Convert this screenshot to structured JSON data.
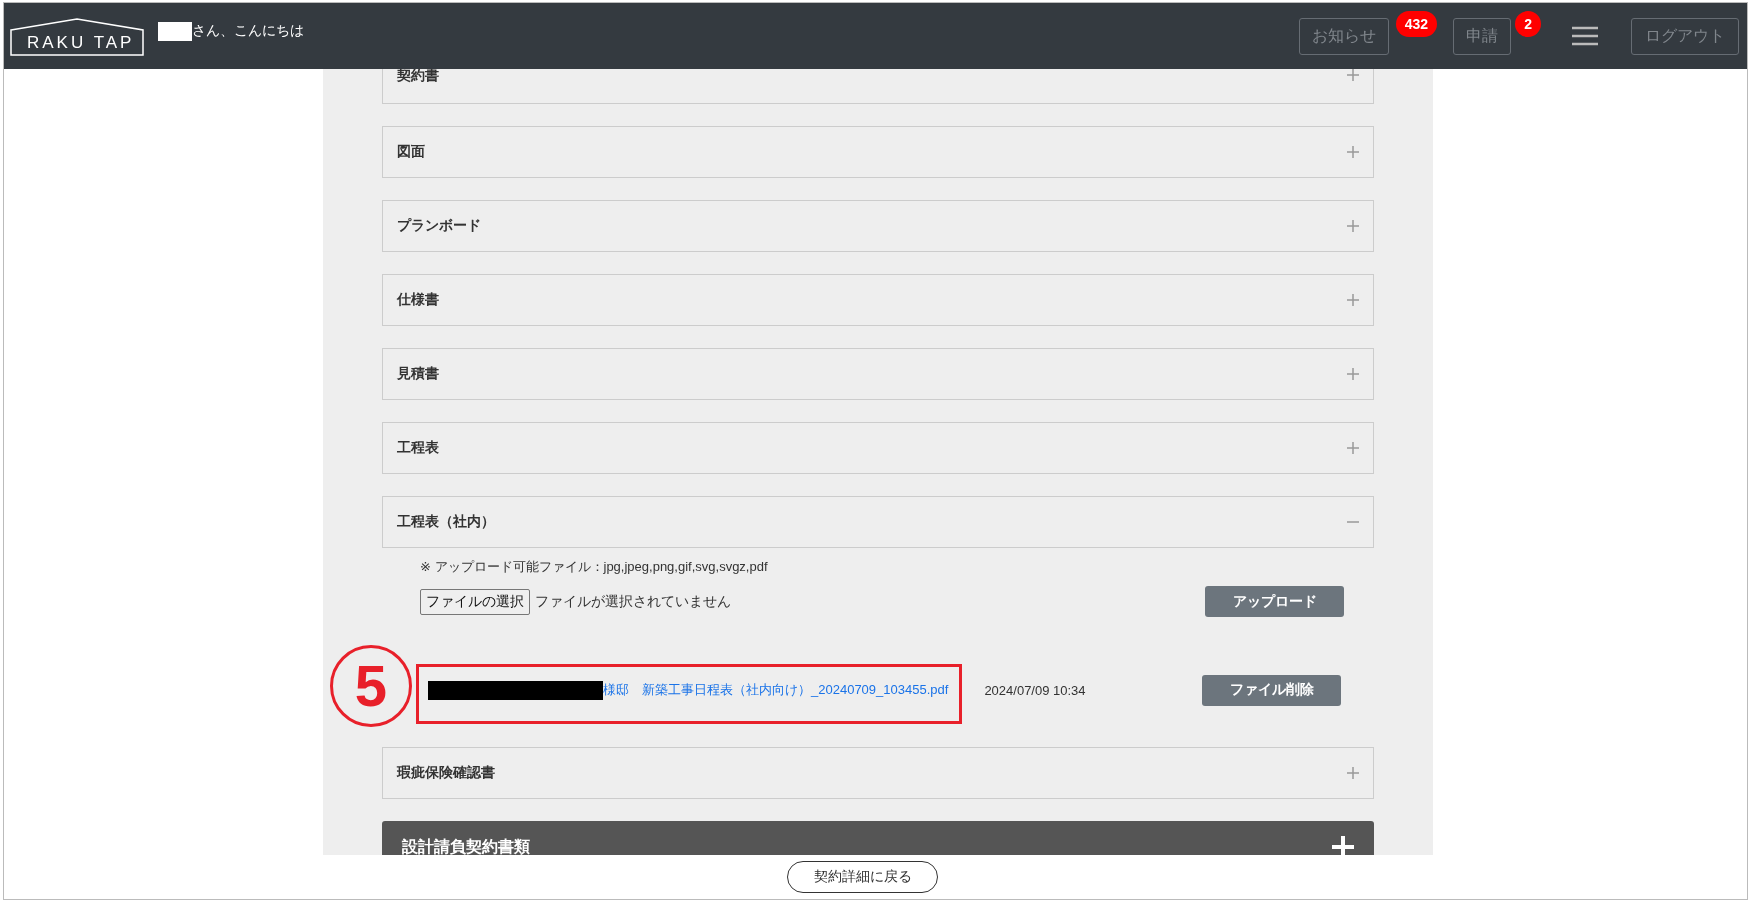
{
  "header": {
    "logo": "RAKU TAP",
    "greeting": "さん、こんにちは",
    "buttons": [
      {
        "label": "お知らせ",
        "badge": "432"
      },
      {
        "label": "申請",
        "badge": "2"
      }
    ],
    "logout": "ログアウト"
  },
  "sections": [
    {
      "title": "契約書",
      "expanded": false
    },
    {
      "title": "図面",
      "expanded": false
    },
    {
      "title": "プランボード",
      "expanded": false
    },
    {
      "title": "仕様書",
      "expanded": false
    },
    {
      "title": "見積書",
      "expanded": false
    },
    {
      "title": "工程表",
      "expanded": false
    },
    {
      "title": "工程表（社内）",
      "expanded": true,
      "note": "※ アップロード可能ファイル：jpg,jpeg,png,gif,svg,svgz,pdf",
      "file_button": "ファイルの選択",
      "file_status": "ファイルが選択されていません",
      "upload": "アップロード",
      "files": [
        {
          "name": "様邸　新築工事日程表（社内向け）_20240709_103455.pdf",
          "date": "2024/07/09 10:34",
          "delete": "ファイル削除"
        }
      ]
    },
    {
      "title": "瑕疵保険確認書",
      "expanded": false
    }
  ],
  "category": {
    "title": "設計請負契約書類",
    "expanded": false
  },
  "annotation": {
    "number": "5"
  },
  "back_button": "契約詳細に戻る"
}
